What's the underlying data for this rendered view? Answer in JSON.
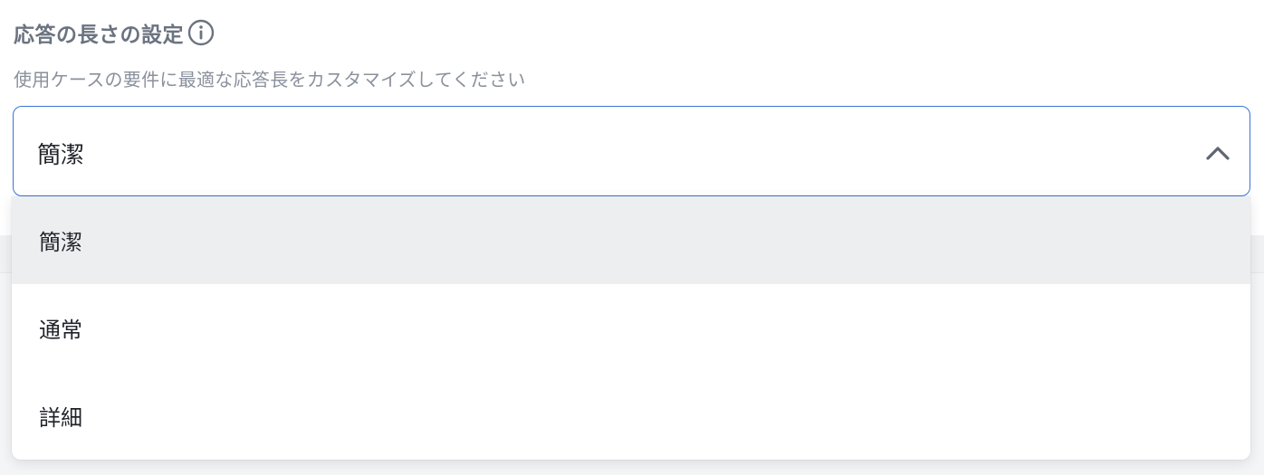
{
  "section": {
    "title": "応答の長さの設定",
    "subtitle": "使用ケースの要件に最適な応答長をカスタマイズしてください",
    "info_icon": "info-circle-icon"
  },
  "select": {
    "value": "簡潔",
    "expanded": true,
    "chevron_icon": "chevron-up-icon",
    "accent_color": "#3b74d9"
  },
  "options": [
    {
      "label": "簡潔",
      "selected": true
    },
    {
      "label": "通常",
      "selected": false
    },
    {
      "label": "詳細",
      "selected": false
    }
  ],
  "colors": {
    "selected_option_bg": "#edeef0",
    "title": "#6b7380",
    "subtitle": "#8a919c"
  }
}
